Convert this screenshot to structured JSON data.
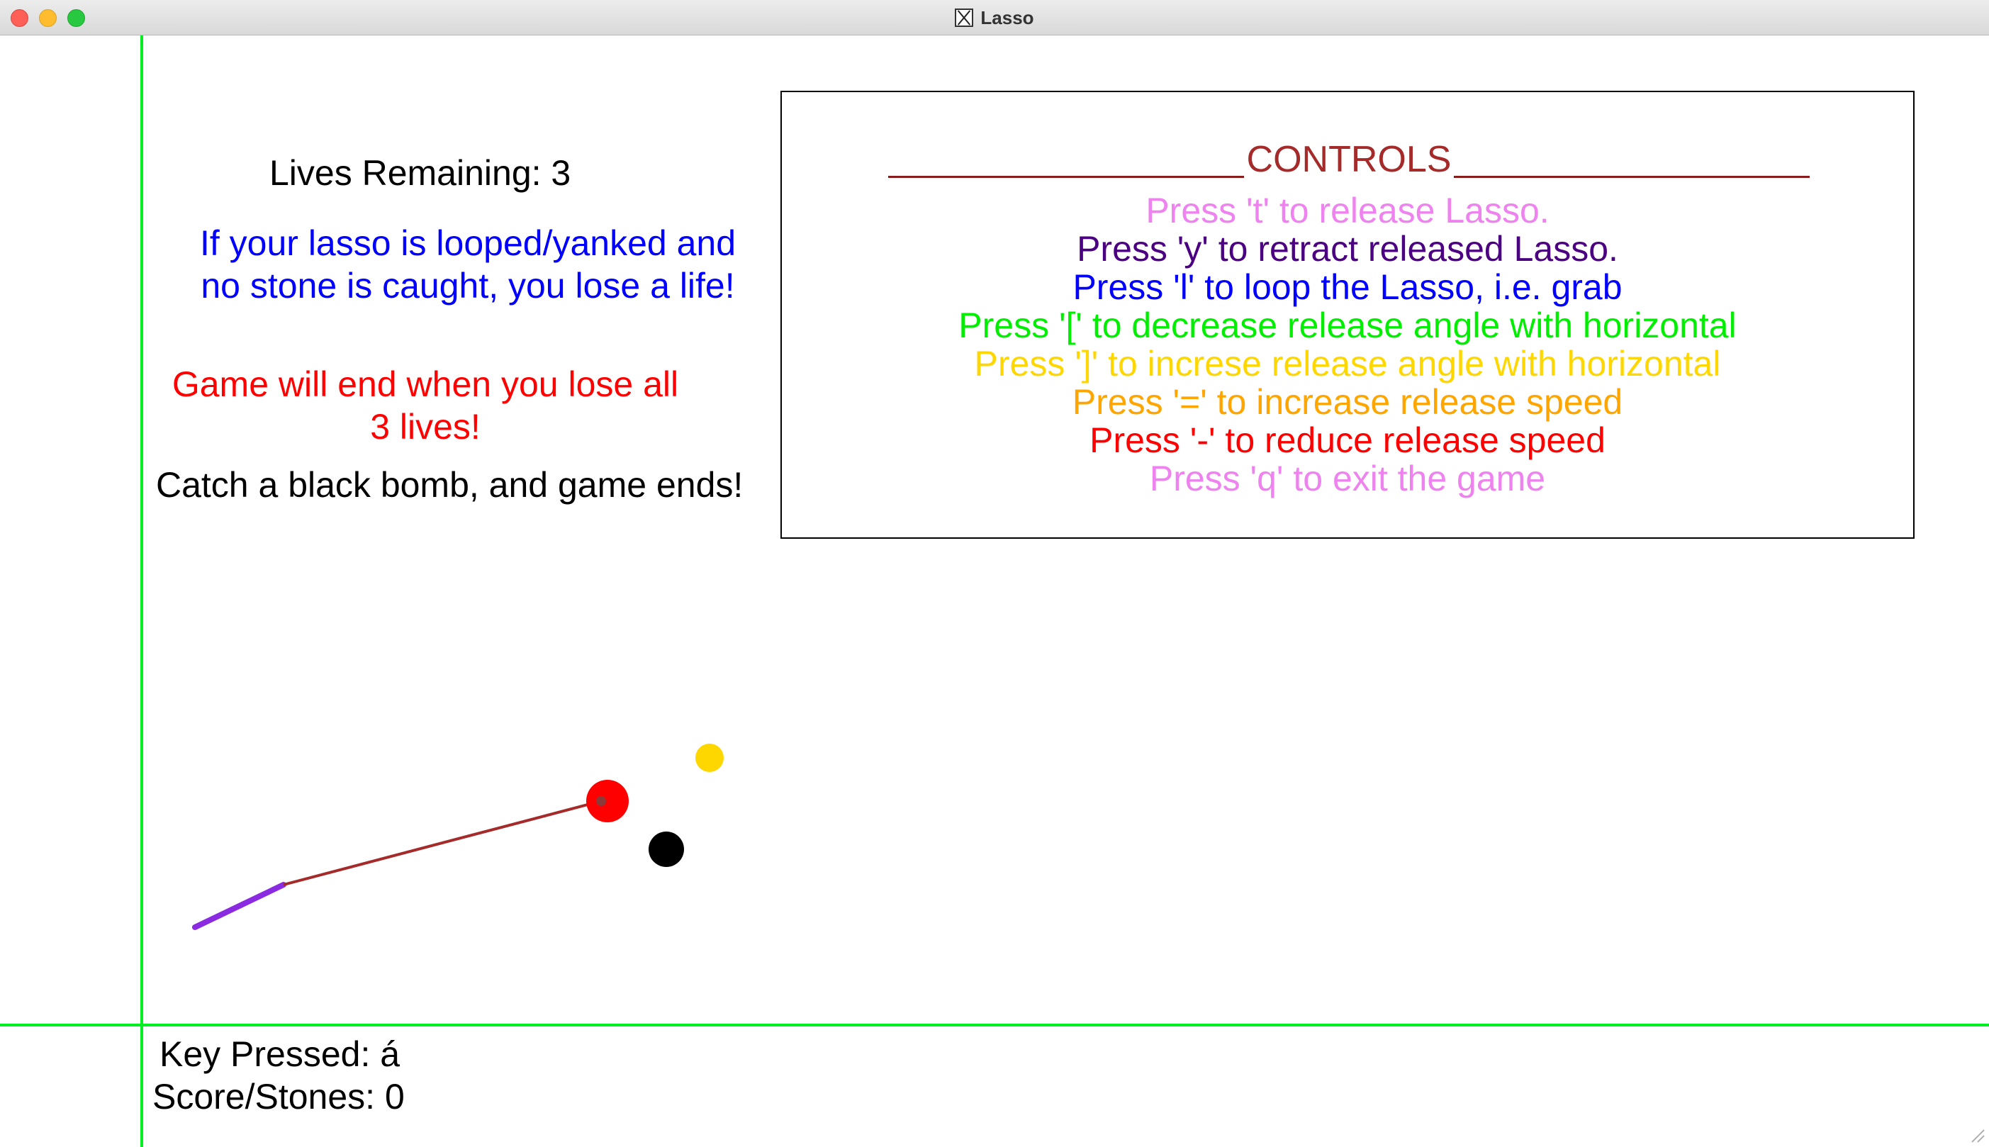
{
  "window": {
    "title": "Lasso"
  },
  "hud": {
    "lives_label": "Lives Remaining: 3",
    "rule_loop": "If your lasso is looped/yanked and no stone is caught, you lose a life!",
    "rule_end": "Game will end when you lose all 3 lives!",
    "rule_bomb": "Catch a black bomb, and game ends!",
    "key_pressed": "Key Pressed: á",
    "score": "Score/Stones: 0"
  },
  "controls": {
    "title": "CONTROLS",
    "items": [
      {
        "text": "Press 't' to release Lasso.",
        "color": "#ee82ee"
      },
      {
        "text": "Press 'y' to retract released Lasso.",
        "color": "#4b0082"
      },
      {
        "text": "Press 'l' to loop the Lasso, i.e. grab",
        "color": "#0000ff"
      },
      {
        "text": "Press '[' to decrease release angle with horizontal",
        "color": "#00ee00"
      },
      {
        "text": "Press ']' to increse release angle with horizontal",
        "color": "#ffd700"
      },
      {
        "text": "Press '=' to increase release speed",
        "color": "#ffa500"
      },
      {
        "text": "Press '-' to reduce release speed",
        "color": "#ff0000"
      },
      {
        "text": "Press 'q' to exit the game",
        "color": "#ee82ee"
      }
    ]
  },
  "colors": {
    "boundary": "#00ee22",
    "lasso_rope": "#a52a2a",
    "lasso_handle": "#8a2be2",
    "lasso_tip": "#ff0000",
    "coin": "#ffd700",
    "bomb": "#000000"
  },
  "icons": {
    "window_icon": "x11-icon"
  }
}
